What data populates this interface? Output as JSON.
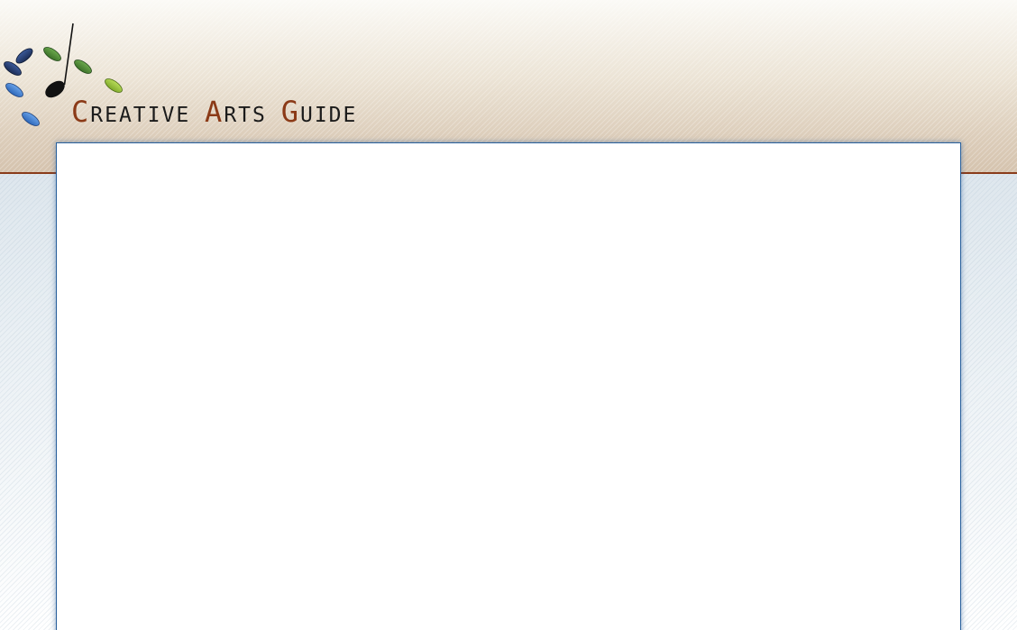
{
  "site": {
    "name": "Creative Arts Guide",
    "wordmark": {
      "word1_initial": "C",
      "word1_rest": "REATIVE ",
      "word2_initial": "A",
      "word2_rest": "RTS ",
      "word3_initial": "G",
      "word3_rest": "UIDE"
    },
    "logo_icon": "music-note-dots-icon"
  },
  "colors": {
    "accent": "#8b3a17",
    "wordmark_text": "#1b1b1b",
    "panel_border": "#275f9c",
    "dot_navy": "#243a6b",
    "dot_blue": "#3f7fd0",
    "dot_green": "#4f8a3a",
    "dot_lime": "#9bc43a",
    "note": "#111111"
  },
  "content": {
    "empty": true
  }
}
